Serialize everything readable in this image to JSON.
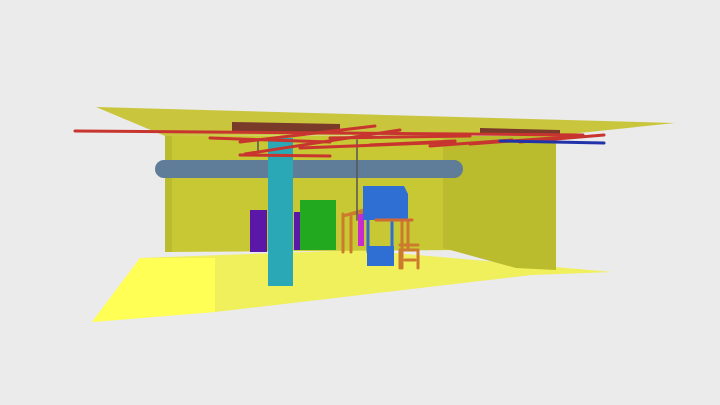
{
  "viewer": {
    "background_color": "#ebebeb"
  },
  "scene": {
    "colors": {
      "floor": "#f0ef5c",
      "floor_light": "#ffff55",
      "back_wall": "#c8c734",
      "side_wall": "#bbbb2e",
      "ceiling": "#c9c63e",
      "column": "#2aa8b5",
      "duct": "#5f7d98",
      "pipe_red": "#c8352f",
      "pipe_orange": "#d06a33",
      "pipe_blue": "#2233aa",
      "panel_purple": "#5a17a8",
      "panel_green": "#22a91f",
      "cabinet_blue": "#2f6fd3",
      "chair_orange": "#cc7a2c",
      "beam_dark": "#7a3a2a"
    },
    "objects": [
      "floor",
      "back-wall",
      "right-wall",
      "ceiling",
      "column",
      "duct",
      "red-pipes",
      "purple-panel",
      "green-panel",
      "blue-cabinet",
      "chair",
      "rack"
    ]
  }
}
